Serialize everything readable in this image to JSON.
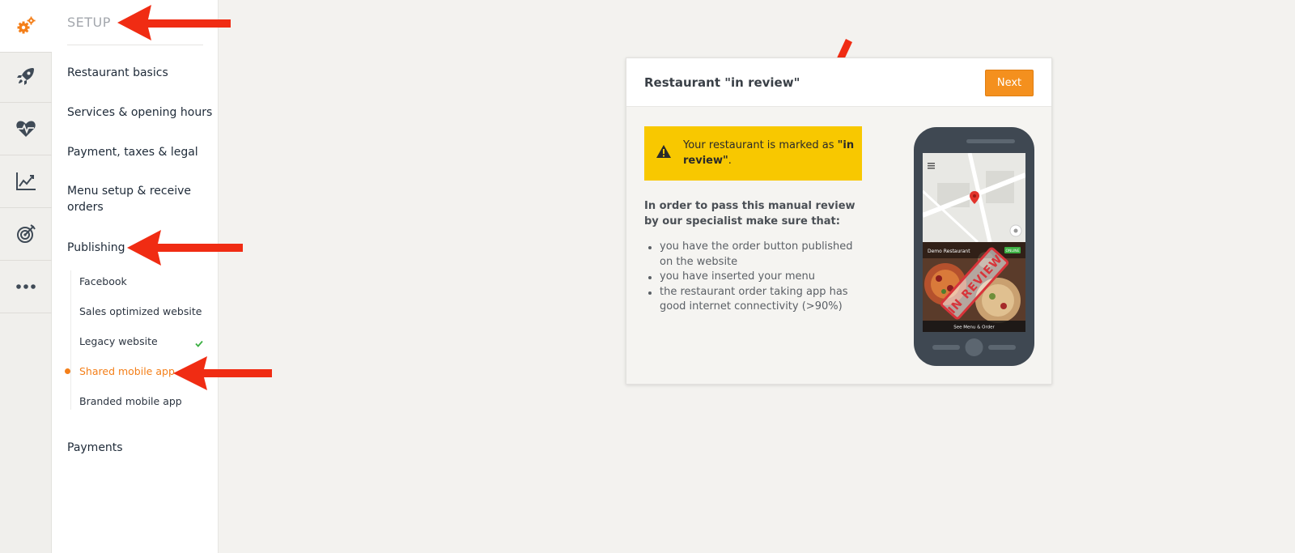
{
  "rail": {
    "items": [
      {
        "name": "gears-icon",
        "active": true
      },
      {
        "name": "rocket-icon",
        "active": false
      },
      {
        "name": "heart-pulse-icon",
        "active": false
      },
      {
        "name": "chart-line-icon",
        "active": false
      },
      {
        "name": "target-icon",
        "active": false
      },
      {
        "name": "more-icon",
        "active": false
      }
    ]
  },
  "sidebar": {
    "section_title": "SETUP",
    "items": [
      {
        "label": "Restaurant basics"
      },
      {
        "label": "Services & opening hours"
      },
      {
        "label": "Payment, taxes & legal"
      },
      {
        "label": "Menu setup & receive orders"
      },
      {
        "label": "Publishing"
      },
      {
        "label": "Payments"
      }
    ],
    "publishing_subitems": [
      {
        "label": "Facebook",
        "completed": false,
        "active": false
      },
      {
        "label": "Sales optimized website",
        "completed": false,
        "active": false
      },
      {
        "label": "Legacy website",
        "completed": true,
        "active": false
      },
      {
        "label": "Shared mobile app",
        "completed": false,
        "active": true
      },
      {
        "label": "Branded mobile app",
        "completed": false,
        "active": false
      }
    ]
  },
  "card": {
    "title": "Restaurant \"in review\"",
    "next_label": "Next",
    "warning": {
      "prefix": "Your restaurant is marked as ",
      "highlight": "\"in review\"",
      "suffix": "."
    },
    "intro": "In order to pass this manual review by our specialist make sure that:",
    "checklist": [
      "you have the order button published on the website",
      "you have inserted your menu",
      "the restaurant order taking app has good internet connectivity (>90%)"
    ],
    "phone": {
      "restaurant_name": "Demo Restaurant",
      "status_badge": "ONLINE",
      "stamp_text": "IN REVIEW",
      "bottom_label": "See Menu & Order"
    }
  },
  "colors": {
    "accent_orange": "#f47f19",
    "warning_yellow": "#f8c800",
    "annotation_red": "#f02c13",
    "check_green": "#3cb043"
  }
}
